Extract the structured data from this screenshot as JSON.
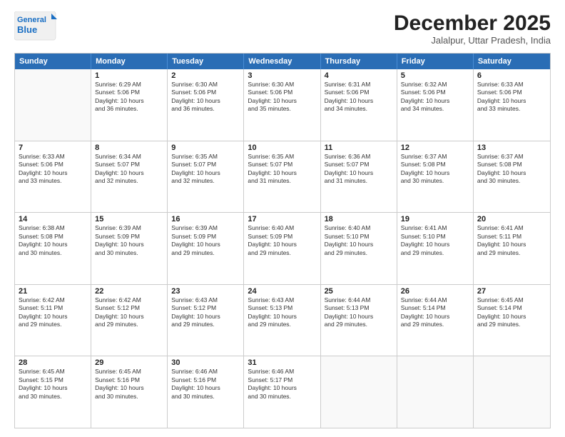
{
  "header": {
    "logo_line1": "General",
    "logo_line2": "Blue",
    "month": "December 2025",
    "location": "Jalalpur, Uttar Pradesh, India"
  },
  "days_of_week": [
    "Sunday",
    "Monday",
    "Tuesday",
    "Wednesday",
    "Thursday",
    "Friday",
    "Saturday"
  ],
  "weeks": [
    [
      {
        "day": "",
        "info": "",
        "shaded": true
      },
      {
        "day": "1",
        "info": "Sunrise: 6:29 AM\nSunset: 5:06 PM\nDaylight: 10 hours\nand 36 minutes.",
        "shaded": false
      },
      {
        "day": "2",
        "info": "Sunrise: 6:30 AM\nSunset: 5:06 PM\nDaylight: 10 hours\nand 36 minutes.",
        "shaded": false
      },
      {
        "day": "3",
        "info": "Sunrise: 6:30 AM\nSunset: 5:06 PM\nDaylight: 10 hours\nand 35 minutes.",
        "shaded": false
      },
      {
        "day": "4",
        "info": "Sunrise: 6:31 AM\nSunset: 5:06 PM\nDaylight: 10 hours\nand 34 minutes.",
        "shaded": false
      },
      {
        "day": "5",
        "info": "Sunrise: 6:32 AM\nSunset: 5:06 PM\nDaylight: 10 hours\nand 34 minutes.",
        "shaded": false
      },
      {
        "day": "6",
        "info": "Sunrise: 6:33 AM\nSunset: 5:06 PM\nDaylight: 10 hours\nand 33 minutes.",
        "shaded": false
      }
    ],
    [
      {
        "day": "7",
        "info": "Sunrise: 6:33 AM\nSunset: 5:06 PM\nDaylight: 10 hours\nand 33 minutes.",
        "shaded": false
      },
      {
        "day": "8",
        "info": "Sunrise: 6:34 AM\nSunset: 5:07 PM\nDaylight: 10 hours\nand 32 minutes.",
        "shaded": false
      },
      {
        "day": "9",
        "info": "Sunrise: 6:35 AM\nSunset: 5:07 PM\nDaylight: 10 hours\nand 32 minutes.",
        "shaded": false
      },
      {
        "day": "10",
        "info": "Sunrise: 6:35 AM\nSunset: 5:07 PM\nDaylight: 10 hours\nand 31 minutes.",
        "shaded": false
      },
      {
        "day": "11",
        "info": "Sunrise: 6:36 AM\nSunset: 5:07 PM\nDaylight: 10 hours\nand 31 minutes.",
        "shaded": false
      },
      {
        "day": "12",
        "info": "Sunrise: 6:37 AM\nSunset: 5:08 PM\nDaylight: 10 hours\nand 30 minutes.",
        "shaded": false
      },
      {
        "day": "13",
        "info": "Sunrise: 6:37 AM\nSunset: 5:08 PM\nDaylight: 10 hours\nand 30 minutes.",
        "shaded": false
      }
    ],
    [
      {
        "day": "14",
        "info": "Sunrise: 6:38 AM\nSunset: 5:08 PM\nDaylight: 10 hours\nand 30 minutes.",
        "shaded": false
      },
      {
        "day": "15",
        "info": "Sunrise: 6:39 AM\nSunset: 5:09 PM\nDaylight: 10 hours\nand 30 minutes.",
        "shaded": false
      },
      {
        "day": "16",
        "info": "Sunrise: 6:39 AM\nSunset: 5:09 PM\nDaylight: 10 hours\nand 29 minutes.",
        "shaded": false
      },
      {
        "day": "17",
        "info": "Sunrise: 6:40 AM\nSunset: 5:09 PM\nDaylight: 10 hours\nand 29 minutes.",
        "shaded": false
      },
      {
        "day": "18",
        "info": "Sunrise: 6:40 AM\nSunset: 5:10 PM\nDaylight: 10 hours\nand 29 minutes.",
        "shaded": false
      },
      {
        "day": "19",
        "info": "Sunrise: 6:41 AM\nSunset: 5:10 PM\nDaylight: 10 hours\nand 29 minutes.",
        "shaded": false
      },
      {
        "day": "20",
        "info": "Sunrise: 6:41 AM\nSunset: 5:11 PM\nDaylight: 10 hours\nand 29 minutes.",
        "shaded": false
      }
    ],
    [
      {
        "day": "21",
        "info": "Sunrise: 6:42 AM\nSunset: 5:11 PM\nDaylight: 10 hours\nand 29 minutes.",
        "shaded": false
      },
      {
        "day": "22",
        "info": "Sunrise: 6:42 AM\nSunset: 5:12 PM\nDaylight: 10 hours\nand 29 minutes.",
        "shaded": false
      },
      {
        "day": "23",
        "info": "Sunrise: 6:43 AM\nSunset: 5:12 PM\nDaylight: 10 hours\nand 29 minutes.",
        "shaded": false
      },
      {
        "day": "24",
        "info": "Sunrise: 6:43 AM\nSunset: 5:13 PM\nDaylight: 10 hours\nand 29 minutes.",
        "shaded": false
      },
      {
        "day": "25",
        "info": "Sunrise: 6:44 AM\nSunset: 5:13 PM\nDaylight: 10 hours\nand 29 minutes.",
        "shaded": false
      },
      {
        "day": "26",
        "info": "Sunrise: 6:44 AM\nSunset: 5:14 PM\nDaylight: 10 hours\nand 29 minutes.",
        "shaded": false
      },
      {
        "day": "27",
        "info": "Sunrise: 6:45 AM\nSunset: 5:14 PM\nDaylight: 10 hours\nand 29 minutes.",
        "shaded": false
      }
    ],
    [
      {
        "day": "28",
        "info": "Sunrise: 6:45 AM\nSunset: 5:15 PM\nDaylight: 10 hours\nand 30 minutes.",
        "shaded": false
      },
      {
        "day": "29",
        "info": "Sunrise: 6:45 AM\nSunset: 5:16 PM\nDaylight: 10 hours\nand 30 minutes.",
        "shaded": false
      },
      {
        "day": "30",
        "info": "Sunrise: 6:46 AM\nSunset: 5:16 PM\nDaylight: 10 hours\nand 30 minutes.",
        "shaded": false
      },
      {
        "day": "31",
        "info": "Sunrise: 6:46 AM\nSunset: 5:17 PM\nDaylight: 10 hours\nand 30 minutes.",
        "shaded": false
      },
      {
        "day": "",
        "info": "",
        "shaded": true
      },
      {
        "day": "",
        "info": "",
        "shaded": true
      },
      {
        "day": "",
        "info": "",
        "shaded": true
      }
    ]
  ]
}
